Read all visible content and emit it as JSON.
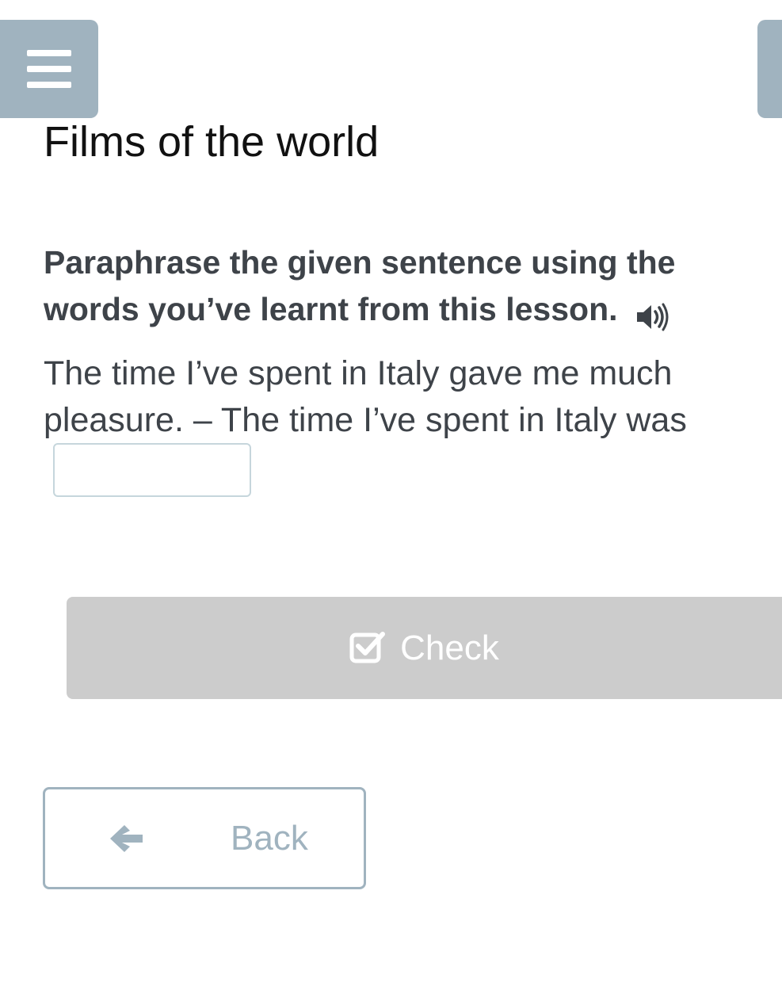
{
  "header": {
    "menu_icon": "hamburger-menu-icon",
    "title": "Films of the world"
  },
  "task": {
    "instruction": "Paraphrase the given sentence using the words you’ve learnt from this lesson.",
    "audio_icon": "speaker-icon",
    "sentence": "The time I’ve spent in Italy gave me much pleasure. – The time I’ve spent in Italy was",
    "answer_value": ""
  },
  "actions": {
    "check_label": "Check",
    "check_icon": "checkbox-check-icon",
    "back_label": "Back",
    "back_icon": "arrow-left-icon"
  },
  "colors": {
    "accent": "#a0b3bf",
    "text": "#3e4349",
    "disabled_button": "#cccccc"
  }
}
